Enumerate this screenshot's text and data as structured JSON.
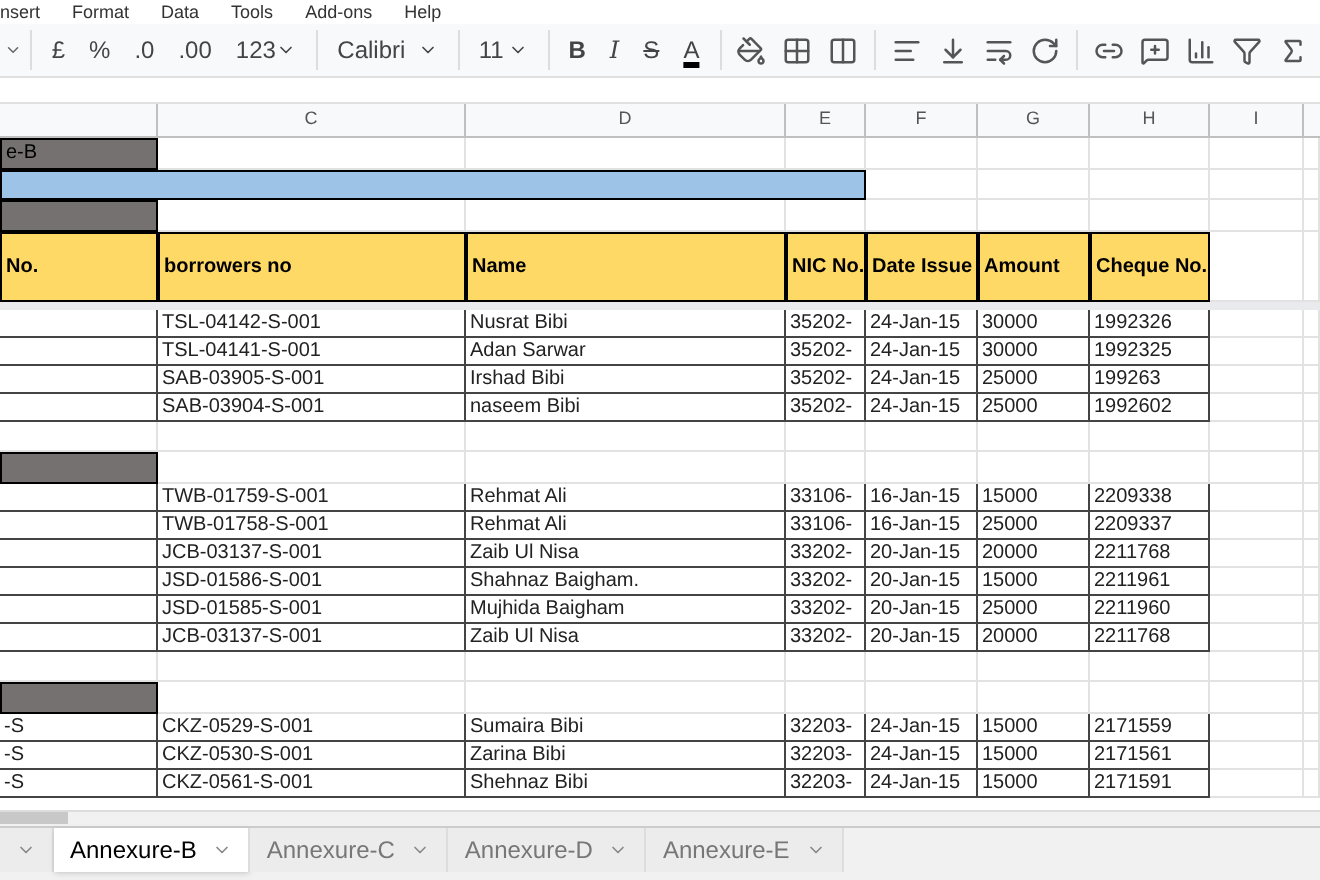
{
  "menu": [
    "nsert",
    "Format",
    "Data",
    "Tools",
    "Add-ons",
    "Help"
  ],
  "toolbar": {
    "currency": "£",
    "percent": "%",
    "decrease_decimals": ".0",
    "increase_decimals": ".00",
    "number_format": "123",
    "font": "Calibri",
    "font_size": "11",
    "bold": "B",
    "italic": "I",
    "strikethrough": "S",
    "text_color": "A"
  },
  "columns": [
    "",
    "C",
    "D",
    "E",
    "F",
    "G",
    "H",
    "I"
  ],
  "rows": [
    {
      "kind": "title",
      "text": "e-B"
    },
    {
      "kind": "banner"
    },
    {
      "kind": "group"
    },
    {
      "kind": "header",
      "cells": [
        "No.",
        "borrowers no",
        "Name",
        "NIC No.",
        "Date Issue",
        "Amount",
        "Cheque No."
      ]
    },
    {
      "kind": "spacer"
    },
    {
      "kind": "data",
      "borrower": "TSL-04142-S-001",
      "name": "Nusrat Bibi",
      "nic": "35202-",
      "date": "24-Jan-15",
      "amount": "30000",
      "cheque": "1992326"
    },
    {
      "kind": "data",
      "borrower": "TSL-04141-S-001",
      "name": "Adan Sarwar",
      "nic": "35202-",
      "date": "24-Jan-15",
      "amount": "30000",
      "cheque": "1992325"
    },
    {
      "kind": "data",
      "borrower": "SAB-03905-S-001",
      "name": "Irshad Bibi",
      "nic": "35202-",
      "date": "24-Jan-15",
      "amount": "25000",
      "cheque": "199263"
    },
    {
      "kind": "data",
      "borrower": "SAB-03904-S-001",
      "name": "naseem Bibi",
      "nic": "35202-",
      "date": "24-Jan-15",
      "amount": "25000",
      "cheque": "1992602"
    },
    {
      "kind": "empty"
    },
    {
      "kind": "group"
    },
    {
      "kind": "data",
      "borrower": "TWB-01759-S-001",
      "name": "Rehmat Ali",
      "nic": "33106-",
      "date": "16-Jan-15",
      "amount": "15000",
      "cheque": "2209338"
    },
    {
      "kind": "data",
      "borrower": "TWB-01758-S-001",
      "name": "Rehmat Ali",
      "nic": "33106-",
      "date": "16-Jan-15",
      "amount": "25000",
      "cheque": "2209337"
    },
    {
      "kind": "data",
      "borrower": "JCB-03137-S-001",
      "name": "Zaib Ul Nisa",
      "nic": "33202-",
      "date": "20-Jan-15",
      "amount": "20000",
      "cheque": "2211768"
    },
    {
      "kind": "data",
      "borrower": "JSD-01586-S-001",
      "name": "Shahnaz Baigham.",
      "nic": "33202-",
      "date": "20-Jan-15",
      "amount": "15000",
      "cheque": "2211961"
    },
    {
      "kind": "data",
      "borrower": "JSD-01585-S-001",
      "name": "Mujhida Baigham",
      "nic": "33202-",
      "date": "20-Jan-15",
      "amount": "25000",
      "cheque": "2211960"
    },
    {
      "kind": "data",
      "borrower": "JCB-03137-S-001",
      "name": "Zaib Ul Nisa",
      "nic": "33202-",
      "date": "20-Jan-15",
      "amount": "20000",
      "cheque": "2211768"
    },
    {
      "kind": "empty"
    },
    {
      "kind": "group"
    },
    {
      "kind": "data",
      "id": "-S",
      "borrower": "CKZ-0529-S-001",
      "name": "Sumaira Bibi",
      "nic": "32203-",
      "date": "24-Jan-15",
      "amount": "15000",
      "cheque": "2171559"
    },
    {
      "kind": "data",
      "id": "-S",
      "borrower": "CKZ-0530-S-001",
      "name": "Zarina Bibi",
      "nic": "32203-",
      "date": "24-Jan-15",
      "amount": "15000",
      "cheque": "2171561"
    },
    {
      "kind": "data",
      "id": "-S",
      "borrower": "CKZ-0561-S-001",
      "name": "Shehnaz Bibi",
      "nic": "32203-",
      "date": "24-Jan-15",
      "amount": "15000",
      "cheque": "2171591"
    }
  ],
  "sheet_tabs": [
    {
      "selected": false
    },
    {
      "label": "Annexure-B",
      "selected": true
    },
    {
      "label": "Annexure-C",
      "selected": false
    },
    {
      "label": "Annexure-D",
      "selected": false
    },
    {
      "label": "Annexure-E",
      "selected": false
    }
  ]
}
